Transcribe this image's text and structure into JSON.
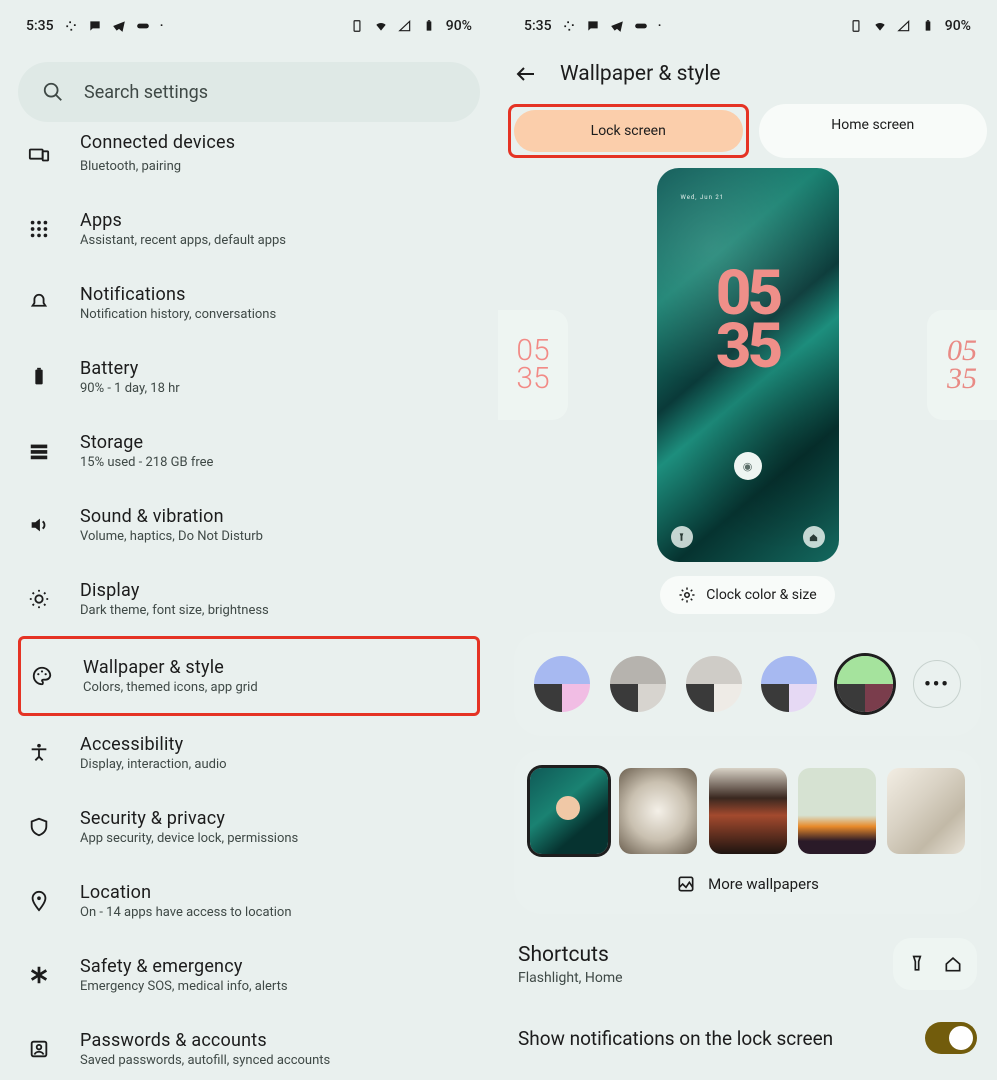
{
  "status": {
    "time": "5:35",
    "battery": "90%"
  },
  "search": {
    "placeholder": "Search settings"
  },
  "settings": [
    {
      "title": "Connected devices",
      "sub": "Bluetooth, pairing"
    },
    {
      "title": "Apps",
      "sub": "Assistant, recent apps, default apps"
    },
    {
      "title": "Notifications",
      "sub": "Notification history, conversations"
    },
    {
      "title": "Battery",
      "sub": "90% - 1 day, 18 hr"
    },
    {
      "title": "Storage",
      "sub": "15% used - 218 GB free"
    },
    {
      "title": "Sound & vibration",
      "sub": "Volume, haptics, Do Not Disturb"
    },
    {
      "title": "Display",
      "sub": "Dark theme, font size, brightness"
    },
    {
      "title": "Wallpaper & style",
      "sub": "Colors, themed icons, app grid"
    },
    {
      "title": "Accessibility",
      "sub": "Display, interaction, audio"
    },
    {
      "title": "Security & privacy",
      "sub": "App security, device lock, permissions"
    },
    {
      "title": "Location",
      "sub": "On - 14 apps have access to location"
    },
    {
      "title": "Safety & emergency",
      "sub": "Emergency SOS, medical info, alerts"
    },
    {
      "title": "Passwords & accounts",
      "sub": "Saved passwords, autofill, synced accounts"
    }
  ],
  "ws": {
    "title": "Wallpaper & style",
    "tabs": {
      "lock": "Lock screen",
      "home": "Home screen"
    },
    "preview": {
      "date": "Wed, Jun 21",
      "clock_top": "05",
      "clock_bot": "35",
      "alt1_top": "05",
      "alt1_bot": "35",
      "alt2_top": "05",
      "alt2_bot": "35"
    },
    "clock_btn": "Clock color & size",
    "palettes": [
      {
        "top": "#a7b9f1",
        "ql": "#3a3a3a",
        "qr": "#f1bde4"
      },
      {
        "top": "#b6b3ae",
        "ql": "#3a3a3a",
        "qr": "#d7d4cf"
      },
      {
        "top": "#cfccc7",
        "ql": "#3a3a3a",
        "qr": "#eeebe6"
      },
      {
        "top": "#a7b9f1",
        "ql": "#3a3a3a",
        "qr": "#e6d9f4"
      },
      {
        "top": "#a5e39d",
        "ql": "#3a3a3a",
        "qr": "#7a3d4c",
        "selected": true
      }
    ],
    "more_wallpapers": "More wallpapers",
    "shortcuts": {
      "title": "Shortcuts",
      "sub": "Flashlight, Home"
    },
    "toggle_label": "Show notifications on the lock screen"
  }
}
